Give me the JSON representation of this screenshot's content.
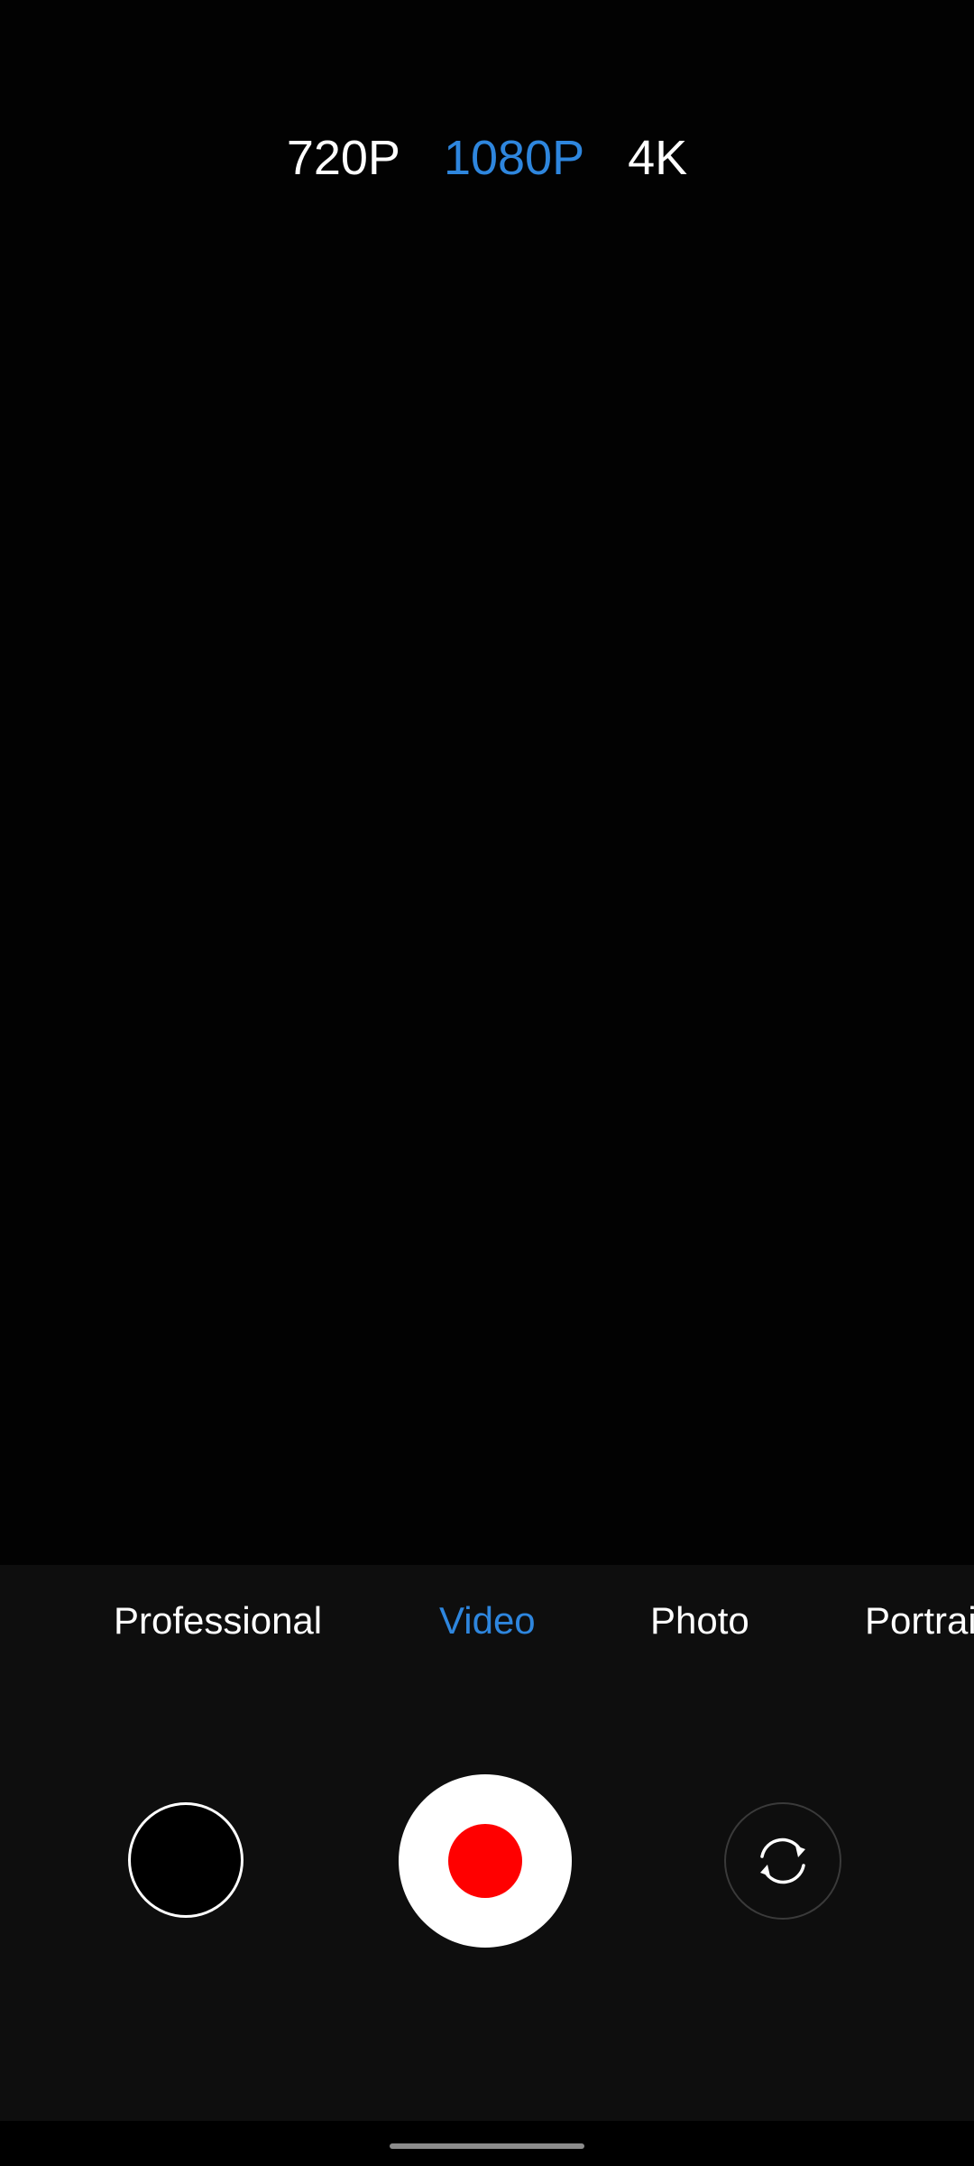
{
  "resolution": {
    "options": [
      "720P",
      "1080P",
      "4K"
    ],
    "selected": "1080P"
  },
  "modes": {
    "items": [
      "Professional",
      "Video",
      "Photo",
      "Portrai"
    ],
    "selected": "Video"
  },
  "controls": {
    "gallery_icon": "gallery-thumbnail",
    "shutter_icon": "record-button",
    "flip_icon": "switch-camera-icon"
  },
  "colors": {
    "accent": "#2e86de",
    "record": "#ff0000",
    "panel": "#0e0e0e"
  }
}
